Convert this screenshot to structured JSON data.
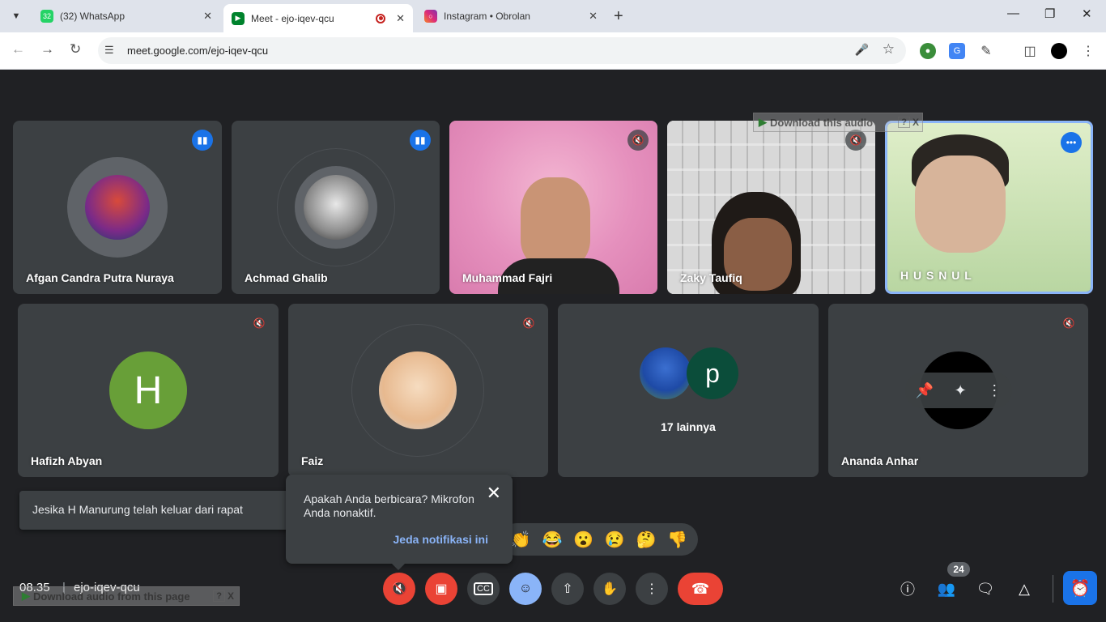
{
  "browser": {
    "tabs": [
      {
        "title": "(32) WhatsApp",
        "badge": "32"
      },
      {
        "title": "Meet - ejo-iqev-qcu"
      },
      {
        "title": "Instagram • Obrolan"
      }
    ],
    "url": "meet.google.com/ejo-iqev-qcu"
  },
  "tiles": {
    "afgan": {
      "name": "Afgan Candra Putra Nuraya"
    },
    "achmad": {
      "name": "Achmad Ghalib"
    },
    "fajri": {
      "name": "Muhammad Fajri"
    },
    "zaky": {
      "name": "Zaky Taufiq"
    },
    "husnul": {
      "name": "H U S N U L"
    },
    "hafizh": {
      "name": "Hafizh Abyan",
      "initial": "H"
    },
    "faiz": {
      "name": "Faiz"
    },
    "others": {
      "label": "17 lainnya",
      "initial": "p"
    },
    "ananda": {
      "name": "Ananda Anhar"
    }
  },
  "overlays": {
    "download_audio": "Download this audio",
    "download_audio_page": "Download audio from this page",
    "q": "?",
    "x": "X"
  },
  "toast": {
    "left_text": "Jesika H Manurung telah keluar dari rapat"
  },
  "notify": {
    "message": "Apakah Anda berbicara? Mikrofon Anda nonaktif.",
    "action": "Jeda notifikasi ini"
  },
  "meeting": {
    "time": "08.35",
    "separator": "|",
    "code": "ejo-iqev-qcu",
    "participants_count": "24"
  },
  "colors": {
    "background": "#202124",
    "tile": "#3c4043",
    "accent_blue": "#1a73e8",
    "red": "#ea4335",
    "hafizh_avatar": "#689f38",
    "others_avatar": "#0b4d3a"
  }
}
